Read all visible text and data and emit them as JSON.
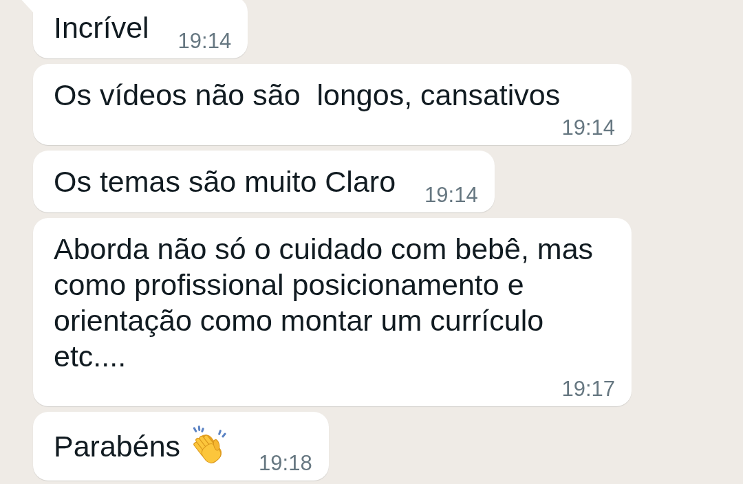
{
  "messages": [
    {
      "text": "Incrível",
      "time": "19:14",
      "tail": true
    },
    {
      "text": "Os vídeos não são  longos, cansativos",
      "time": "19:14",
      "tail": false
    },
    {
      "text": "Os temas são muito Claro",
      "time": "19:14",
      "tail": false
    },
    {
      "text": "Aborda não só o cuidado com bebê, mas como profissional posicionamento e orientação como montar um currículo etc....",
      "time": "19:17",
      "tail": false
    },
    {
      "text": "Parabéns",
      "emoji": true,
      "time": "19:18",
      "tail": false
    }
  ]
}
